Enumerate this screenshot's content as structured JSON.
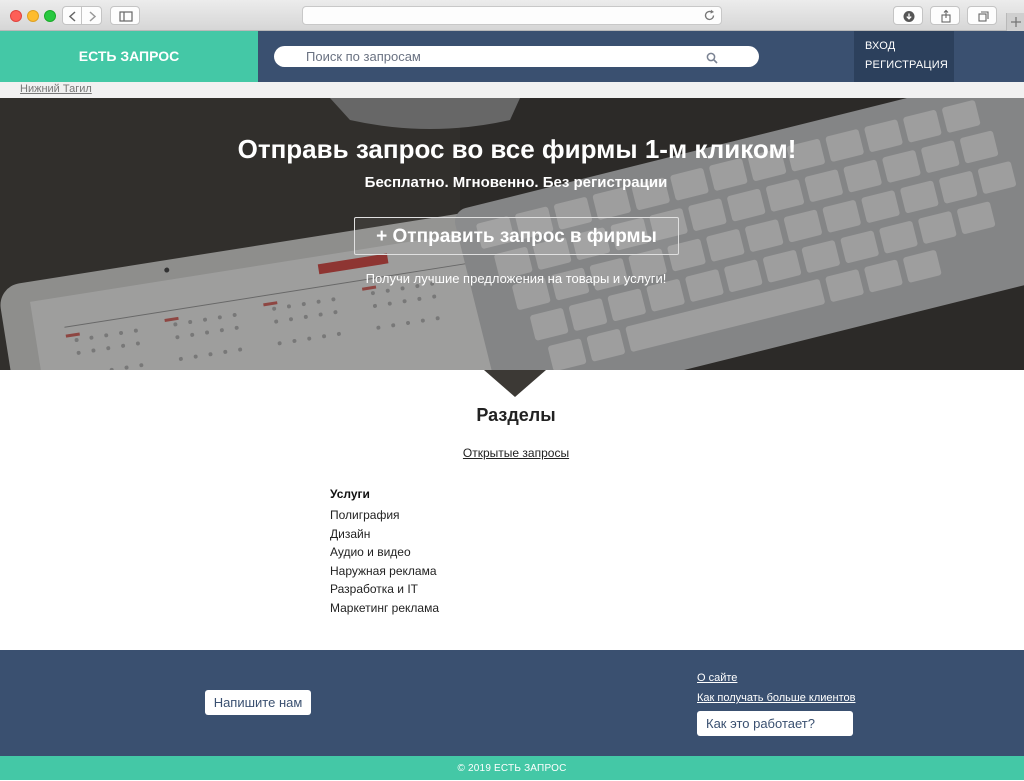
{
  "browser": {
    "url": "",
    "icons": [
      "back-icon",
      "forward-icon",
      "sidebar-icon",
      "reload-icon",
      "download-icon",
      "share-icon",
      "tabs-icon",
      "plus-icon"
    ]
  },
  "header": {
    "logo": "ЕСТЬ ЗАПРОС",
    "search_placeholder": "Поиск по запросам",
    "login": "ВХОД",
    "register": "РЕГИСТРАЦИЯ",
    "colors": {
      "navy": "#3a5070",
      "teal": "#44c8a6",
      "auth_bg": "#2c405c"
    }
  },
  "city": "Нижний Тагил",
  "hero": {
    "title": "Отправь запрос во все фирмы 1-м кликом!",
    "subtitle": "Бесплатно. Мгновенно. Без регистрации",
    "cta": "+ Отправить запрос в фирмы",
    "note": "Получи лучшие предложения на товары и услуги!"
  },
  "sections": {
    "title": "Разделы",
    "open_requests": "Открытые запросы",
    "services_heading": "Услуги",
    "services": [
      "Полиграфия",
      "Дизайн",
      "Аудио и видео",
      "Наружная реклама",
      "Разработка и IT",
      "Маркетинг реклама"
    ]
  },
  "footer": {
    "write_us": "Напишите нам",
    "about": "О сайте",
    "more_clients": "Как получать больше клиентов",
    "how_it_works": "Как это работает?",
    "copyright": "© 2019 ЕСТЬ ЗАПРОС"
  }
}
